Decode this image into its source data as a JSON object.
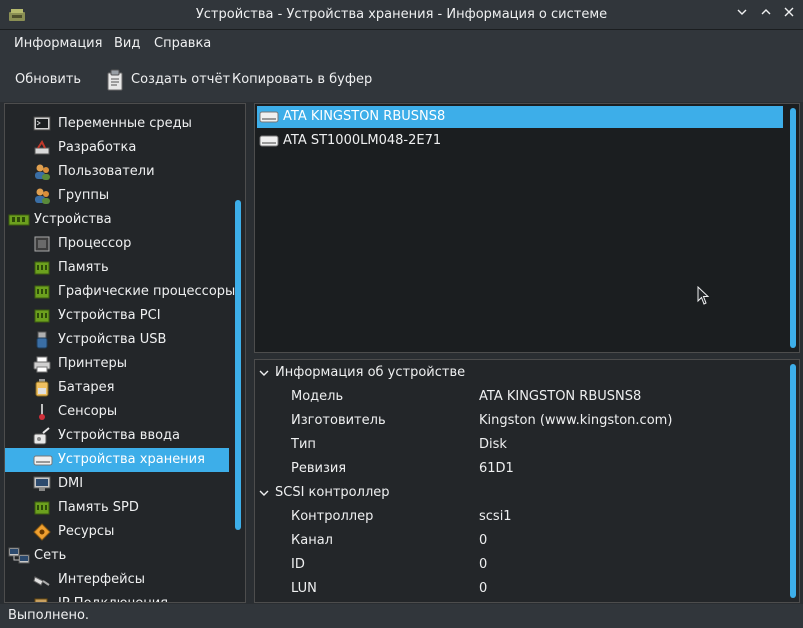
{
  "window": {
    "title": "Устройства - Устройства хранения - Информация о системе"
  },
  "menubar": {
    "items": [
      "Информация",
      "Вид",
      "Справка"
    ]
  },
  "toolbar": {
    "refresh": "Обновить",
    "report": "Создать отчёт",
    "copy": "Копировать в буфер"
  },
  "tree": {
    "items": [
      {
        "label": "Переменные среды",
        "icon": "terminal-icon"
      },
      {
        "label": "Разработка",
        "icon": "development-icon"
      },
      {
        "label": "Пользователи",
        "icon": "users-icon"
      },
      {
        "label": "Группы",
        "icon": "groups-icon"
      },
      {
        "label": "Устройства",
        "icon": "devices-icon"
      },
      {
        "label": "Процессор",
        "icon": "cpu-icon"
      },
      {
        "label": "Память",
        "icon": "memory-icon"
      },
      {
        "label": "Графические процессоры",
        "icon": "gpu-icon"
      },
      {
        "label": "Устройства PCI",
        "icon": "pci-icon"
      },
      {
        "label": "Устройства USB",
        "icon": "usb-icon"
      },
      {
        "label": "Принтеры",
        "icon": "printer-icon"
      },
      {
        "label": "Батарея",
        "icon": "battery-icon"
      },
      {
        "label": "Сенсоры",
        "icon": "sensor-icon"
      },
      {
        "label": "Устройства ввода",
        "icon": "input-devices-icon"
      },
      {
        "label": "Устройства хранения",
        "icon": "storage-icon"
      },
      {
        "label": "DMI",
        "icon": "dmi-icon"
      },
      {
        "label": "Память SPD",
        "icon": "spd-memory-icon"
      },
      {
        "label": "Ресурсы",
        "icon": "resources-icon"
      },
      {
        "label": "Сеть",
        "icon": "network-icon"
      },
      {
        "label": "Интерфейсы",
        "icon": "interfaces-icon"
      },
      {
        "label": "IP Подключения",
        "icon": "ip-connections-icon"
      }
    ],
    "selected": "Устройства хранения"
  },
  "devices": {
    "items": [
      "ATA KINGSTON RBUSNS8",
      "ATA ST1000LM048-2E71"
    ],
    "selected": "ATA KINGSTON RBUSNS8"
  },
  "info": {
    "sections": [
      {
        "title": "Информация об устройстве",
        "rows": [
          {
            "key": "Модель",
            "value": "ATA KINGSTON RBUSNS8"
          },
          {
            "key": "Изготовитель",
            "value": "Kingston (www.kingston.com)"
          },
          {
            "key": "Тип",
            "value": "Disk"
          },
          {
            "key": "Ревизия",
            "value": "61D1"
          }
        ]
      },
      {
        "title": "SCSI контроллер",
        "rows": [
          {
            "key": "Контроллер",
            "value": "scsi1"
          },
          {
            "key": "Канал",
            "value": "0"
          },
          {
            "key": "ID",
            "value": "0"
          },
          {
            "key": "LUN",
            "value": "0"
          }
        ]
      }
    ]
  },
  "status": {
    "text": "Выполнено."
  },
  "colors": {
    "accent": "#3daee9",
    "window_bg": "#31363b",
    "view_bg": "#232629"
  }
}
